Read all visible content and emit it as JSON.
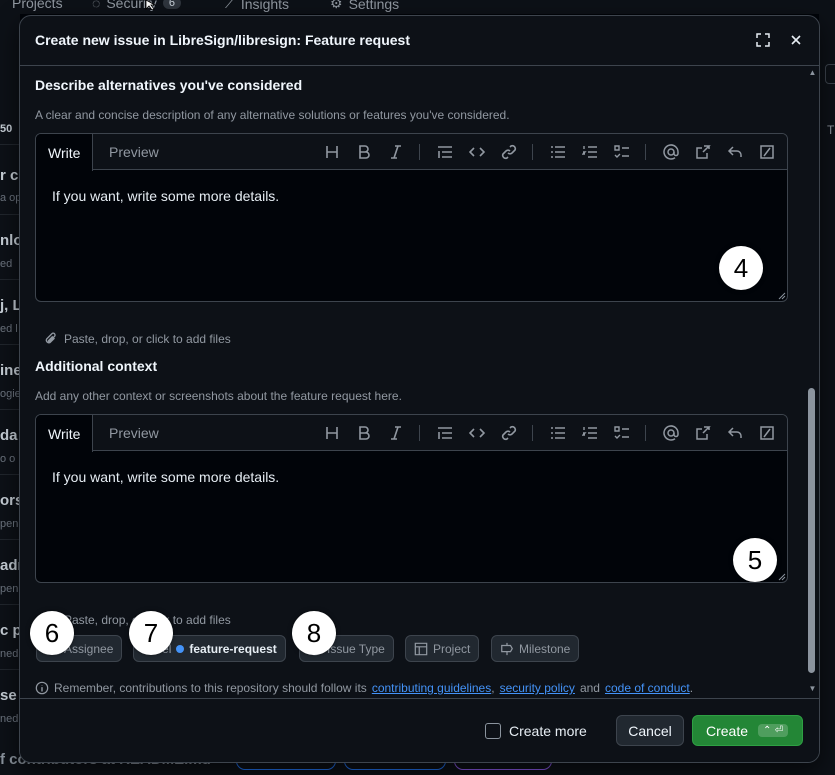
{
  "background": {
    "nav": [
      {
        "label": "Projects",
        "icon": "table-icon"
      },
      {
        "label": "Security",
        "icon": "shield-icon",
        "count": "6"
      },
      {
        "label": "Insights",
        "icon": "graph-icon"
      },
      {
        "label": "Settings",
        "icon": "gear-icon"
      }
    ],
    "left_fragments": [
      "50",
      "r c",
      "a op",
      "nlo",
      "ed",
      "j, L",
      "ed l",
      "ine",
      "ogie",
      "da",
      "o o",
      "ors",
      "pen",
      "adr",
      "pen",
      "c p",
      "ned",
      "se",
      "ned"
    ],
    "right_fragment": "T",
    "footer_fragment": "f contributors at README.md"
  },
  "dialog": {
    "title": "Create new issue in LibreSign/libresign: Feature request",
    "sections": [
      {
        "label": "Describe alternatives you've considered",
        "description": "A clear and concise description of any alternative solutions or features you've considered.",
        "tab_write": "Write",
        "tab_preview": "Preview",
        "placeholder": "If you want, write some more details.",
        "attach": "Paste, drop, or click to add files",
        "marker": "4"
      },
      {
        "label": "Additional context",
        "description": "Add any other context or screenshots about the feature request here.",
        "tab_write": "Write",
        "tab_preview": "Preview",
        "placeholder": "If you want, write some more details.",
        "attach": "Paste, drop, or click to add files",
        "marker": "5"
      }
    ],
    "toolbar_icons": [
      "heading-icon",
      "bold-icon",
      "italic-icon",
      "quote-icon",
      "code-icon",
      "link-icon",
      "unordered-list-icon",
      "ordered-list-icon",
      "task-list-icon",
      "mention-icon",
      "cross-reference-icon",
      "reply-icon",
      "slash-command-icon"
    ],
    "metadata": {
      "assignee": "Assignee",
      "label_prefix": "Label",
      "label_value": "feature-request",
      "label_color": "#4493f8",
      "issue_type": "Issue Type",
      "project": "Project",
      "milestone": "Milestone",
      "markers": [
        "6",
        "7",
        "8"
      ]
    },
    "notice": {
      "prefix": "Remember, contributions to this repository should follow its",
      "link1": "contributing guidelines",
      "sep": ",",
      "link2": "security policy",
      "and": "and",
      "link3": "code of conduct",
      "suffix": "."
    },
    "footer": {
      "create_more": "Create more",
      "cancel": "Cancel",
      "create": "Create",
      "shortcut": "⌃ ⏎"
    }
  },
  "colors": {
    "accent": "#4493f8",
    "create_button": "#238636",
    "dialog_bg": "#0d1117",
    "border": "#3d444d"
  }
}
